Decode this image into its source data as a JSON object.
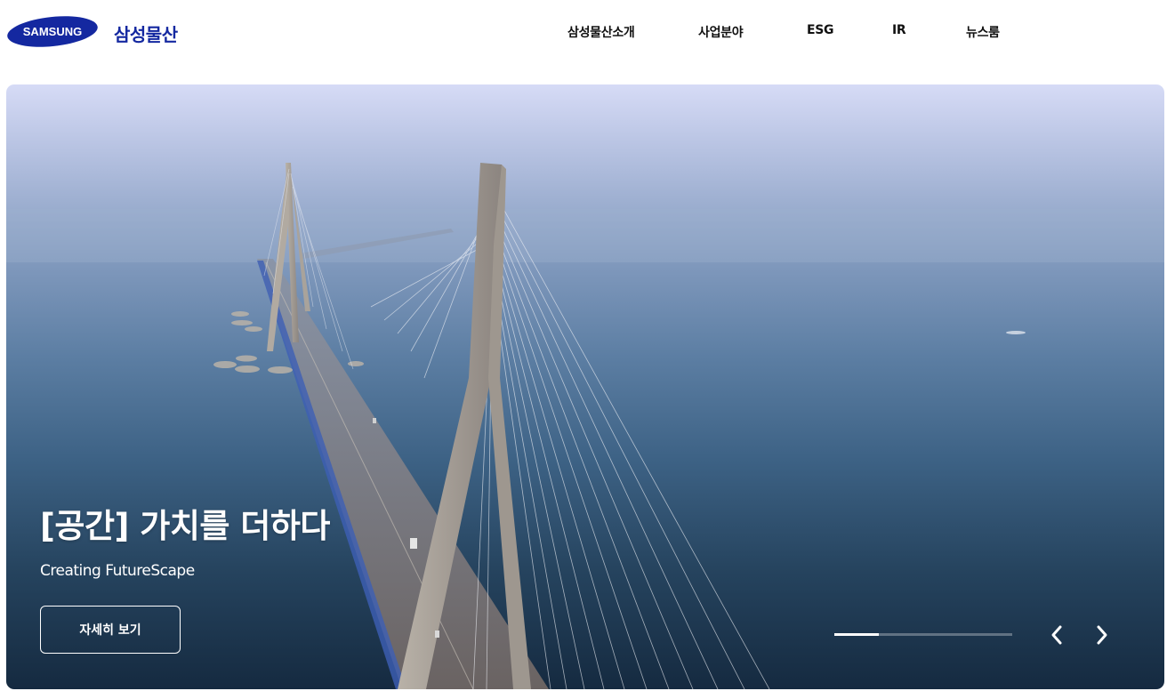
{
  "header": {
    "logo_text": "SAMSUNG",
    "brand": "삼성물산",
    "nav": [
      "삼성물산소개",
      "사업분야",
      "ESG",
      "IR",
      "뉴스룸"
    ]
  },
  "hero": {
    "title": "[공간] 가치를 더하다",
    "subtitle": "Creating FutureScape",
    "button_label": "자세히 보기",
    "slide_progress": 0.25,
    "prev_icon": "chevron-left-icon",
    "next_icon": "chevron-right-icon"
  },
  "colors": {
    "brand_blue": "#1428a0",
    "nav_text": "#111111",
    "hero_text": "#ffffff"
  }
}
